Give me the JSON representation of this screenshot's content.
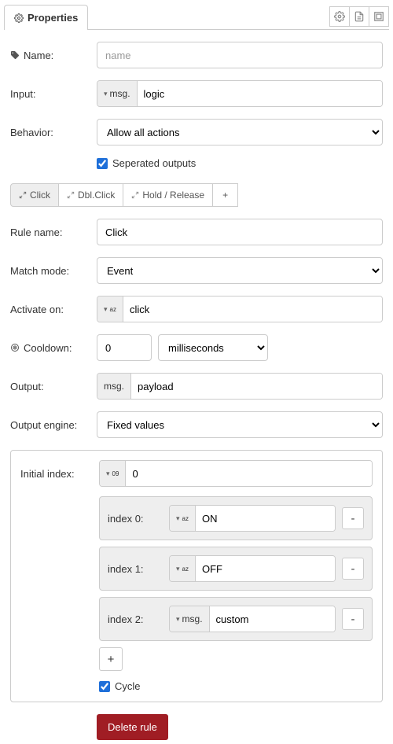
{
  "header": {
    "tab_label": "Properties"
  },
  "fields": {
    "name_label": "Name:",
    "name_placeholder": "name",
    "input_label": "Input:",
    "input_prefix": "msg.",
    "input_value": "logic",
    "behavior_label": "Behavior:",
    "behavior_value": "Allow all actions",
    "separated_outputs_label": "Seperated outputs",
    "separated_outputs_checked": true
  },
  "mode_tabs": [
    {
      "label": "Click",
      "active": true
    },
    {
      "label": "Dbl.Click",
      "active": false
    },
    {
      "label": "Hold / Release",
      "active": false
    }
  ],
  "rule": {
    "rule_name_label": "Rule name:",
    "rule_name_value": "Click",
    "match_mode_label": "Match mode:",
    "match_mode_value": "Event",
    "activate_on_label": "Activate on:",
    "activate_on_value": "click",
    "cooldown_label": "Cooldown:",
    "cooldown_value": "0",
    "cooldown_unit": "milliseconds",
    "output_label": "Output:",
    "output_prefix": "msg.",
    "output_value": "payload",
    "output_engine_label": "Output engine:",
    "output_engine_value": "Fixed values"
  },
  "engine": {
    "initial_index_label": "Initial index:",
    "initial_index_value": "0",
    "items": [
      {
        "label": "index 0:",
        "type": "az",
        "value": "ON"
      },
      {
        "label": "index 1:",
        "type": "az",
        "value": "OFF"
      },
      {
        "label": "index 2:",
        "type": "msg",
        "prefix": "msg.",
        "value": "custom"
      }
    ],
    "cycle_label": "Cycle",
    "cycle_checked": true
  },
  "delete_label": "Delete rule"
}
